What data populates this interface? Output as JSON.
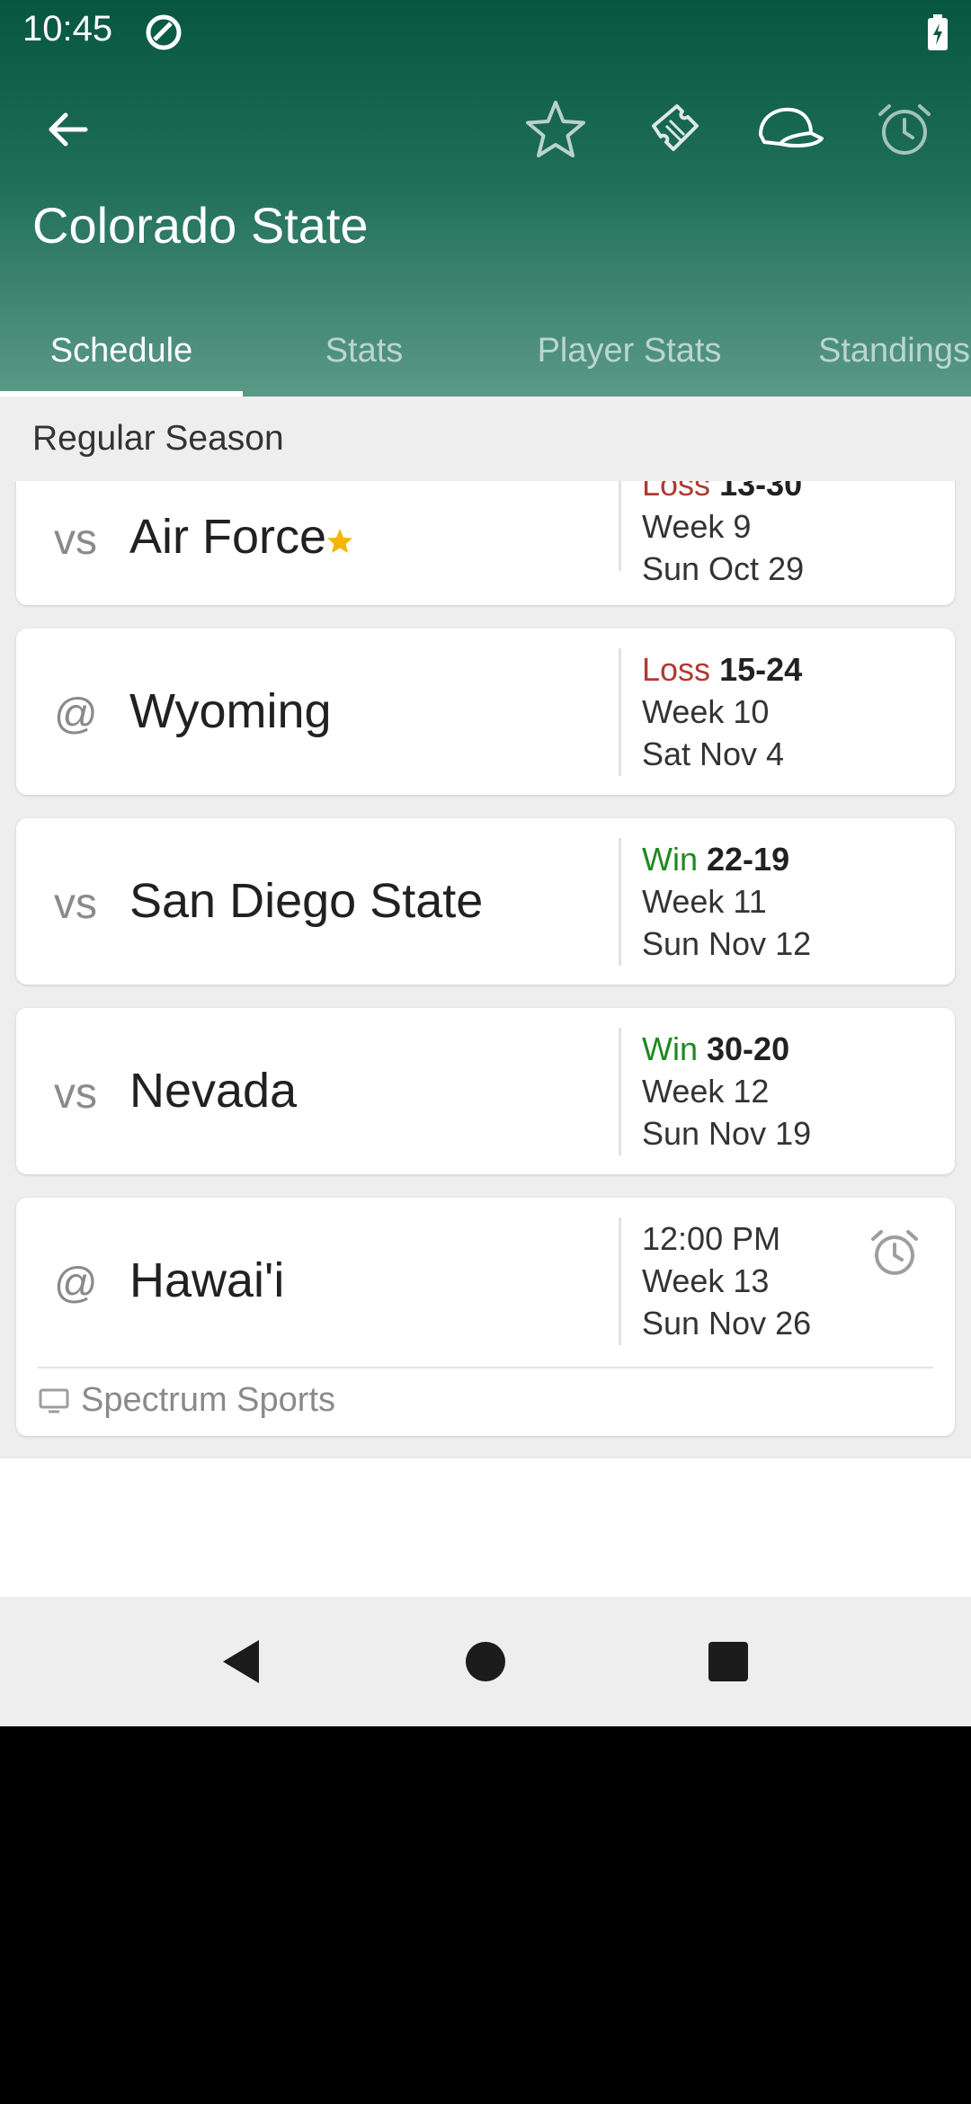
{
  "status_bar": {
    "time": "10:45"
  },
  "header": {
    "title": "Colorado State"
  },
  "tabs": [
    {
      "label": "Schedule",
      "active": true
    },
    {
      "label": "Stats"
    },
    {
      "label": "Player Stats"
    },
    {
      "label": "Standings"
    }
  ],
  "section": {
    "title": "Regular Season"
  },
  "games": [
    {
      "location": "vs",
      "opponent": "Air Force",
      "favorite": true,
      "result": "Loss",
      "score": "13-30",
      "week": "Week 9",
      "date": "Sun Oct 29"
    },
    {
      "location": "@",
      "opponent": "Wyoming",
      "result": "Loss",
      "score": "15-24",
      "week": "Week 10",
      "date": "Sat Nov 4"
    },
    {
      "location": "vs",
      "opponent": "San Diego State",
      "result": "Win",
      "score": "22-19",
      "week": "Week 11",
      "date": "Sun Nov 12"
    },
    {
      "location": "vs",
      "opponent": "Nevada",
      "result": "Win",
      "score": "30-20",
      "week": "Week 12",
      "date": "Sun Nov 19"
    },
    {
      "location": "@",
      "opponent": "Hawai'i",
      "time": "12:00 PM",
      "week": "Week 13",
      "date": "Sun Nov 26",
      "broadcast": "Spectrum Sports"
    }
  ],
  "colors": {
    "header": "#075640",
    "win": "#1e8a1e",
    "loss": "#b03a32",
    "favorite_star": "#f5b400"
  },
  "icons": [
    "back-arrow-icon",
    "star-outline-icon",
    "tickets-icon",
    "cap-icon",
    "alarm-clock-icon",
    "tv-icon",
    "nav-back-icon",
    "nav-home-icon",
    "nav-recents-icon"
  ]
}
